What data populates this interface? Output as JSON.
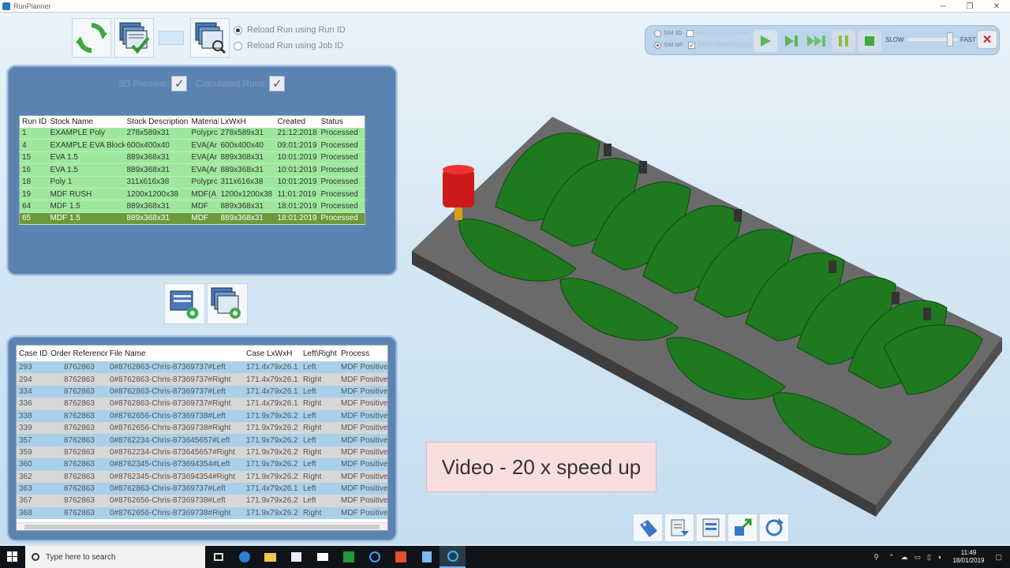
{
  "window": {
    "title": "RunPlanner",
    "minimize": "─",
    "maximize": "❐",
    "close": "✕"
  },
  "toolbar": {
    "reload_options": [
      {
        "label": "Reload Run using Run ID",
        "selected": true
      },
      {
        "label": "Reload Run using Job ID",
        "selected": false
      }
    ]
  },
  "run_panel": {
    "preview_label": "3D Preview",
    "calc_label": "Calculated Runs",
    "columns": [
      "Run ID",
      "Stock Name",
      "Stock Description",
      "Material",
      "LxWxH",
      "Created",
      "Status"
    ],
    "rows": [
      [
        "1",
        "EXAMPLE Poly",
        "278x589x31",
        "Polyprc",
        "278x589x31",
        "21:12:2018",
        "Processed"
      ],
      [
        "4",
        "EXAMPLE EVA Block",
        "600x400x40",
        "EVA(Ar",
        "600x400x40",
        "09:01:2019",
        "Processed"
      ],
      [
        "15",
        "EVA 1.5",
        "889x368x31",
        "EVA(Ar",
        "889x368x31",
        "10:01:2019",
        "Processed"
      ],
      [
        "16",
        "EVA 1.5",
        "889x368x31",
        "EVA(Ar",
        "889x368x31",
        "10:01:2019",
        "Processed"
      ],
      [
        "18",
        "Poly 1",
        "311x616x38",
        "Polyprc",
        "311x616x38",
        "10:01:2019",
        "Processed"
      ],
      [
        "19",
        "MDF RUSH",
        "1200x1200x38",
        "MDF(A",
        "1200x1200x38",
        "11:01:2019",
        "Processed"
      ],
      [
        "64",
        "MDF 1.5",
        "889x368x31",
        "MDF",
        "889x368x31",
        "18:01:2019",
        "Processed"
      ],
      [
        "65",
        "MDF 1.5",
        "889x368x31",
        "MDF",
        "889x368x31",
        "18:01:2019",
        "Processed"
      ]
    ],
    "selected_index": 7
  },
  "case_panel": {
    "columns": [
      "Case ID",
      "Order Reference",
      "File Name",
      "Case LxWxH",
      "Left\\Right",
      "Process"
    ],
    "rows": [
      [
        "293",
        "8762863",
        "0#8762863-Chris-87369737#Left",
        "171.4x79x26.1",
        "Left",
        "MDF Positive"
      ],
      [
        "294",
        "8762863",
        "0#8762863-Chris-87369737#Right",
        "171.4x79x26.1",
        "Right",
        "MDF Positive"
      ],
      [
        "334",
        "8762863",
        "0#8762863-Chris-87369737#Left",
        "171.4x79x26.1",
        "Left",
        "MDF Positive"
      ],
      [
        "336",
        "8762863",
        "0#8762863-Chris-87369737#Right",
        "171.4x79x26.1",
        "Right",
        "MDF Positive"
      ],
      [
        "338",
        "8762863",
        "0#8762656-Chris-87369738#Left",
        "171.9x79x26.2",
        "Left",
        "MDF Positive"
      ],
      [
        "339",
        "8762863",
        "0#8762656-Chris-87369738#Right",
        "171.9x79x26.2",
        "Right",
        "MDF Positive"
      ],
      [
        "357",
        "8762863",
        "0#8762234-Chris-873645657#Left",
        "171.9x79x26.2",
        "Left",
        "MDF Positive"
      ],
      [
        "359",
        "8762863",
        "0#8762234-Chris-873645657#Right",
        "171.9x79x26.2",
        "Right",
        "MDF Positive"
      ],
      [
        "360",
        "8762863",
        "0#8762345-Chris-873694354#Left",
        "171.9x79x26.2",
        "Left",
        "MDF Positive"
      ],
      [
        "362",
        "8762863",
        "0#8762345-Chris-873694354#Right",
        "171.9x79x26.2",
        "Right",
        "MDF Positive"
      ],
      [
        "363",
        "8762863",
        "0#8762863-Chris-87369737#Left",
        "171.4x79x26.1",
        "Left",
        "MDF Positive"
      ],
      [
        "367",
        "8762863",
        "0#8762656-Chris-87369738#Left",
        "171.9x79x26.2",
        "Left",
        "MDF Positive"
      ],
      [
        "368",
        "8762863",
        "0#8762656-Chris-87369738#Right",
        "171.9x79x26.2",
        "Right",
        "MDF Positive"
      ]
    ]
  },
  "sim_controls": {
    "sim3d_label": "SIM 3D",
    "simwf_label": "SIM WF",
    "check_collisions_label": "CHECK COLLISIONS",
    "stop_when_found_label": "STOP WHEN FOUND",
    "slow_label": "SLOW",
    "fast_label": "FAST",
    "speed_level": 0.85
  },
  "overlay": {
    "text": "Video - 20 x speed up"
  },
  "taskbar": {
    "search_placeholder": "Type here to search",
    "time": "11:49",
    "date": "18/01/2019"
  },
  "colors": {
    "panel": "#5b83b1",
    "run_row": "#9ee89e",
    "run_row_selected": "#6b9a3a",
    "case_row_blue": "#a9d0ea",
    "case_row_grey": "#d7d7d7",
    "toolpath": "#1f7a1f"
  }
}
